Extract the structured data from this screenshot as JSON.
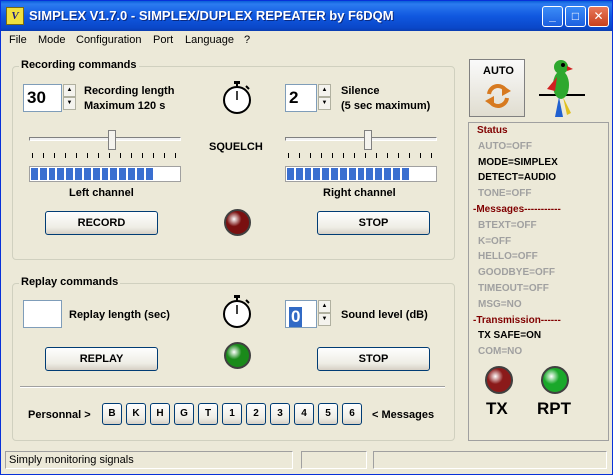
{
  "window": {
    "title": "SIMPLEX V1.7.0 - SIMPLEX/DUPLEX REPEATER by F6DQM"
  },
  "menu": [
    "File",
    "Mode",
    "Configuration",
    "Port",
    "Language",
    "?"
  ],
  "recording": {
    "title": "Recording commands",
    "length_value": "30",
    "length_label": "Recording length",
    "length_max": "Maximum 120 s",
    "silence_value": "2",
    "silence_label": "Silence",
    "silence_max": "(5 sec maximum)",
    "squelch_label": "SQUELCH",
    "left_channel": "Left channel",
    "right_channel": "Right channel",
    "left_squelch_level": 0.52,
    "right_squelch_level": 0.52,
    "left_vu_level": 0.8,
    "right_vu_level": 0.8,
    "record_button": "RECORD",
    "stop_button": "STOP"
  },
  "replay": {
    "title": "Replay commands",
    "length_value": "",
    "length_label": "Replay length (sec)",
    "sound_value": "0",
    "sound_label": "Sound level (dB)",
    "replay_button": "REPLAY",
    "stop_button": "STOP",
    "personnal_label": "Personnal >",
    "messages_label": "< Messages",
    "keys": [
      "B",
      "K",
      "H",
      "G",
      "T",
      "1",
      "2",
      "3",
      "4",
      "5",
      "6"
    ]
  },
  "auto_button": "AUTO",
  "status": {
    "lines": [
      {
        "text": "Status",
        "style": "maroon"
      },
      {
        "text": "AUTO=OFF",
        "style": "gray"
      },
      {
        "text": "MODE=SIMPLEX",
        "style": "dark"
      },
      {
        "text": "DETECT=AUDIO",
        "style": "dark"
      },
      {
        "text": "TONE=OFF",
        "style": "gray"
      },
      {
        "text": "-Messages-----------",
        "style": "maroon"
      },
      {
        "text": "BTEXT=OFF",
        "style": "gray"
      },
      {
        "text": "K=OFF",
        "style": "gray"
      },
      {
        "text": "HELLO=OFF",
        "style": "gray"
      },
      {
        "text": "GOODBYE=OFF",
        "style": "gray"
      },
      {
        "text": "TIMEOUT=OFF",
        "style": "gray"
      },
      {
        "text": "MSG=NO",
        "style": "gray"
      },
      {
        "text": "-Transmission------",
        "style": "maroon"
      },
      {
        "text": "TX SAFE=ON",
        "style": "dark"
      },
      {
        "text": "COM=NO",
        "style": "gray"
      }
    ],
    "tx_label": "TX",
    "rpt_label": "RPT"
  },
  "colors": {
    "tx_led": "#8b1a1a",
    "rpt_led": "#1aa82a",
    "record_led": "#7a1010",
    "replay_led": "#1a8a1a",
    "vu": "#3a6fd0"
  },
  "statusbar": {
    "message": "Simply monitoring signals"
  }
}
